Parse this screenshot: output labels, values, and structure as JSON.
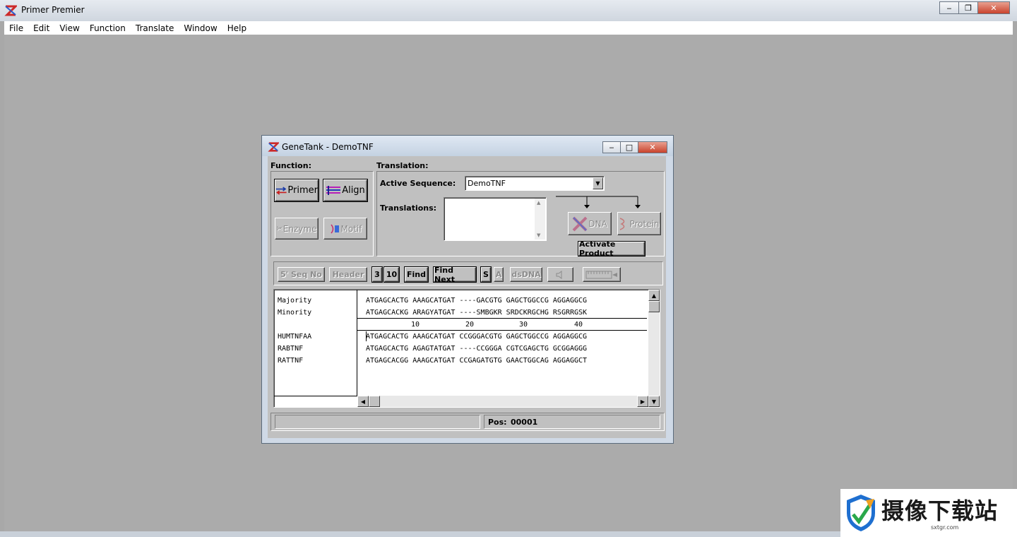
{
  "app": {
    "title": "Primer Premier",
    "menu": [
      "File",
      "Edit",
      "View",
      "Function",
      "Translate",
      "Window",
      "Help"
    ]
  },
  "window": {
    "title": "GeneTank - DemoTNF",
    "function_label": "Function:",
    "translation_label": "Translation:",
    "function_buttons": {
      "primer": "Primer",
      "align": "Align",
      "enzyme": "Enzyme",
      "motif": "Motif"
    },
    "active_sequence_label": "Active Sequence:",
    "active_sequence_value": "DemoTNF",
    "translations_label": "Translations:",
    "dna_button": "DNA",
    "protein_button": "Protein",
    "activate_product_button": "Activate Product",
    "toolbar": {
      "seq_no": "5' Seq No",
      "header": "Header",
      "three": "3",
      "ten": "10",
      "find": "Find",
      "find_next": "Find Next",
      "s": "S",
      "a": "A",
      "dsdna": "dsDNA"
    },
    "alignment": {
      "consensus": [
        {
          "name": "Majority",
          "seq": "ATGAGCACTG AAAGCATGAT ----GACGTG GAGCTGGCCG AGGAGGCG"
        },
        {
          "name": "Minority",
          "seq": "ATGAGCACKG ARAGYATGAT ----SMBGKR SRDCKRGCHG RSGRRGSK"
        }
      ],
      "ruler": [
        "10",
        "20",
        "30",
        "40"
      ],
      "sequences": [
        {
          "name": "HUMTNFAA",
          "seq": "ATGAGCACTG AAAGCATGAT CCGGGACGTG GAGCTGGCCG AGGAGGCG"
        },
        {
          "name": "RABTNF",
          "seq": "ATGAGCACTG AGAGTATGAT ----CCGGGA CGTCGAGCTG GCGGAGGG"
        },
        {
          "name": "RATTNF",
          "seq": "ATGAGCACGG AAAGCATGAT CCGAGATGTG GAACTGGCAG AGGAGGCT"
        }
      ]
    },
    "status": {
      "left": "",
      "pos_label": "Pos:",
      "pos_value": "00001"
    }
  },
  "watermark": {
    "text": "摄像下载站",
    "url": "sxtgr.com"
  }
}
